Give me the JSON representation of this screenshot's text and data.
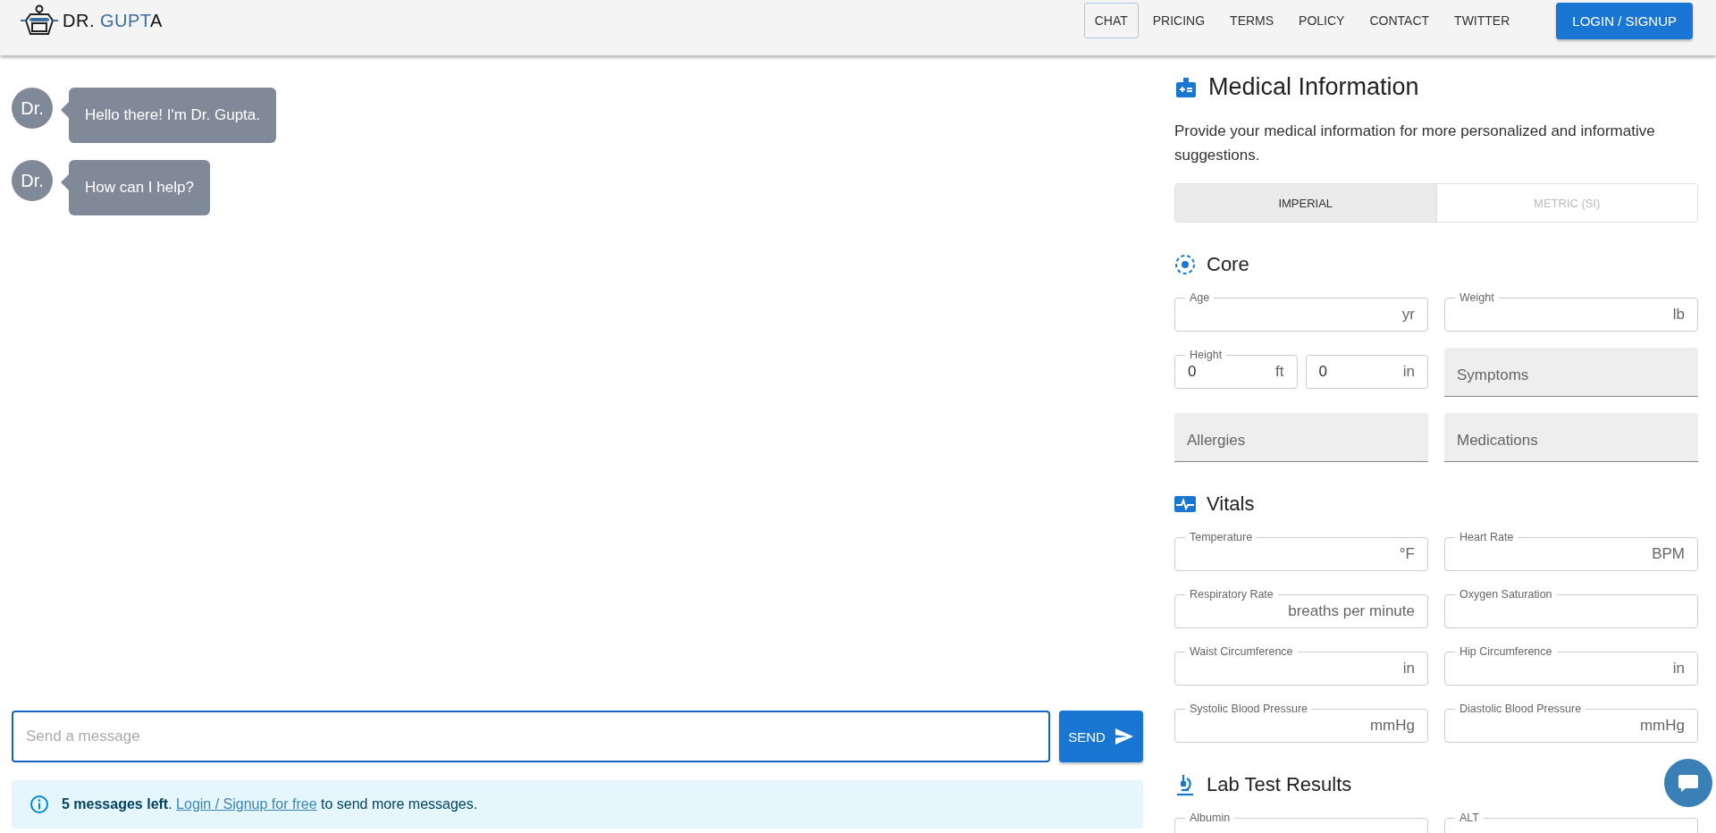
{
  "header": {
    "logo": [
      {
        "text": "DR. ",
        "accent": false
      },
      {
        "text": "GUPT",
        "accent": true
      },
      {
        "text": "A",
        "accent": false
      }
    ],
    "nav": [
      {
        "label": "CHAT",
        "selected": true
      },
      {
        "label": "PRICING",
        "selected": false
      },
      {
        "label": "TERMS",
        "selected": false
      },
      {
        "label": "POLICY",
        "selected": false
      },
      {
        "label": "CONTACT",
        "selected": false
      },
      {
        "label": "TWITTER",
        "selected": false
      }
    ],
    "login_button": "LOGIN / SIGNUP"
  },
  "chat": {
    "messages": [
      {
        "avatar": "Dr.",
        "text": "Hello there! I'm Dr. Gupta."
      },
      {
        "avatar": "Dr.",
        "text": "How can I help?"
      }
    ],
    "composer": {
      "placeholder": "Send a message",
      "send_button": "SEND"
    },
    "notice": {
      "lead": "**5 messages left**.",
      "link": "Login / Signup for free",
      "tail": "to send more messages."
    }
  },
  "medical_panel": {
    "title": "Medical Information",
    "description": "Provide your medical information for more personalized and informative suggestions.",
    "unit_tabs": [
      {
        "label": "IMPERIAL",
        "selected": true
      },
      {
        "label": "METRIC (SI)",
        "selected": false
      }
    ],
    "sections": [
      {
        "kind": "core",
        "title": "Core",
        "fields": [
          {
            "kind": "outlined",
            "label": "Age",
            "unit": "yr"
          },
          {
            "kind": "outlined",
            "label": "Weight",
            "unit": "lb"
          },
          {
            "kind": "split",
            "label": "Height",
            "parts": [
              {
                "value": "0",
                "unit": "ft"
              },
              {
                "value": "0",
                "unit": "in"
              }
            ]
          },
          {
            "kind": "filled",
            "placeholder": "Symptoms"
          },
          {
            "kind": "filled",
            "placeholder": "Allergies"
          },
          {
            "kind": "filled",
            "placeholder": "Medications"
          }
        ]
      },
      {
        "kind": "vitals",
        "title": "Vitals",
        "fields": [
          {
            "kind": "outlined",
            "label": "Temperature",
            "unit": "°F"
          },
          {
            "kind": "outlined",
            "label": "Heart Rate",
            "unit": "BPM"
          },
          {
            "kind": "outlined",
            "label": "Respiratory Rate",
            "unit": "breaths per minute"
          },
          {
            "kind": "outlined",
            "label": "Oxygen Saturation"
          },
          {
            "kind": "outlined",
            "label": "Waist Circumference",
            "unit": "in"
          },
          {
            "kind": "outlined",
            "label": "Hip Circumference",
            "unit": "in"
          },
          {
            "kind": "outlined",
            "label": "Systolic Blood Pressure",
            "unit": "mmHg"
          },
          {
            "kind": "outlined",
            "label": "Diastolic Blood Pressure",
            "unit": "mmHg"
          }
        ]
      },
      {
        "kind": "lab",
        "title": "Lab Test Results",
        "fields": [
          {
            "kind": "outlined",
            "label": "Albumin"
          },
          {
            "kind": "outlined",
            "label": "ALT"
          }
        ]
      }
    ]
  }
}
